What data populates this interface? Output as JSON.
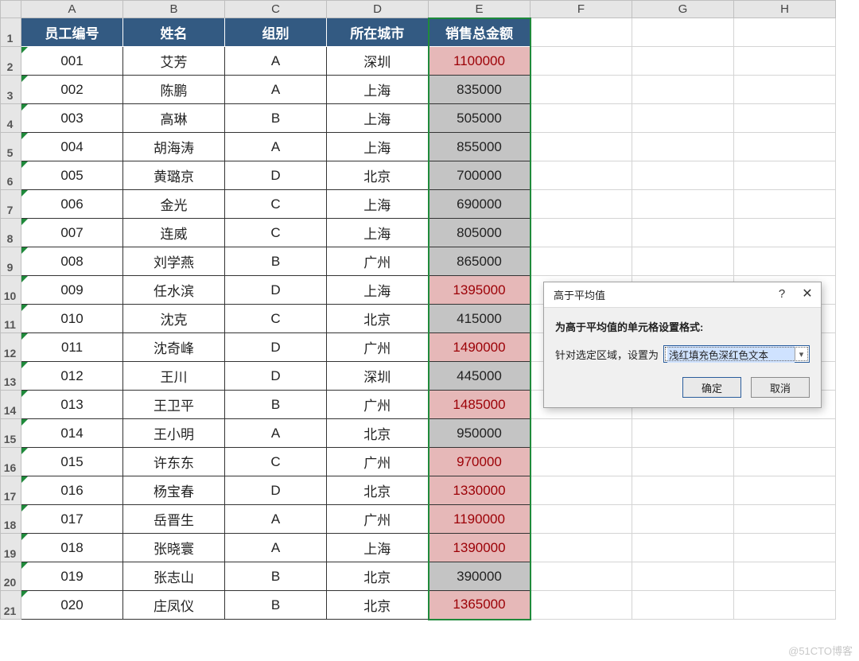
{
  "columns": [
    "A",
    "B",
    "C",
    "D",
    "E",
    "F",
    "G",
    "H"
  ],
  "row_numbers": [
    1,
    2,
    3,
    4,
    5,
    6,
    7,
    8,
    9,
    10,
    11,
    12,
    13,
    14,
    15,
    16,
    17,
    18,
    19,
    20,
    21
  ],
  "headers": {
    "A": "员工编号",
    "B": "姓名",
    "C": "组别",
    "D": "所在城市",
    "E": "销售总金额"
  },
  "rows": [
    {
      "id": "001",
      "name": "艾芳",
      "group": "A",
      "city": "深圳",
      "amount": "1100000",
      "hot": true
    },
    {
      "id": "002",
      "name": "陈鹏",
      "group": "A",
      "city": "上海",
      "amount": "835000",
      "hot": false
    },
    {
      "id": "003",
      "name": "高琳",
      "group": "B",
      "city": "上海",
      "amount": "505000",
      "hot": false
    },
    {
      "id": "004",
      "name": "胡海涛",
      "group": "A",
      "city": "上海",
      "amount": "855000",
      "hot": false
    },
    {
      "id": "005",
      "name": "黄璐京",
      "group": "D",
      "city": "北京",
      "amount": "700000",
      "hot": false
    },
    {
      "id": "006",
      "name": "金光",
      "group": "C",
      "city": "上海",
      "amount": "690000",
      "hot": false
    },
    {
      "id": "007",
      "name": "连威",
      "group": "C",
      "city": "上海",
      "amount": "805000",
      "hot": false
    },
    {
      "id": "008",
      "name": "刘学燕",
      "group": "B",
      "city": "广州",
      "amount": "865000",
      "hot": false
    },
    {
      "id": "009",
      "name": "任水滨",
      "group": "D",
      "city": "上海",
      "amount": "1395000",
      "hot": true
    },
    {
      "id": "010",
      "name": "沈克",
      "group": "C",
      "city": "北京",
      "amount": "415000",
      "hot": false
    },
    {
      "id": "011",
      "name": "沈奇峰",
      "group": "D",
      "city": "广州",
      "amount": "1490000",
      "hot": true
    },
    {
      "id": "012",
      "name": "王川",
      "group": "D",
      "city": "深圳",
      "amount": "445000",
      "hot": false
    },
    {
      "id": "013",
      "name": "王卫平",
      "group": "B",
      "city": "广州",
      "amount": "1485000",
      "hot": true
    },
    {
      "id": "014",
      "name": "王小明",
      "group": "A",
      "city": "北京",
      "amount": "950000",
      "hot": false
    },
    {
      "id": "015",
      "name": "许东东",
      "group": "C",
      "city": "广州",
      "amount": "970000",
      "hot": true
    },
    {
      "id": "016",
      "name": "杨宝春",
      "group": "D",
      "city": "北京",
      "amount": "1330000",
      "hot": true
    },
    {
      "id": "017",
      "name": "岳晋生",
      "group": "A",
      "city": "广州",
      "amount": "1190000",
      "hot": true
    },
    {
      "id": "018",
      "name": "张晓寰",
      "group": "A",
      "city": "上海",
      "amount": "1390000",
      "hot": true
    },
    {
      "id": "019",
      "name": "张志山",
      "group": "B",
      "city": "北京",
      "amount": "390000",
      "hot": false
    },
    {
      "id": "020",
      "name": "庄凤仪",
      "group": "B",
      "city": "北京",
      "amount": "1365000",
      "hot": true
    }
  ],
  "dialog": {
    "title": "高于平均值",
    "heading": "为高于平均值的单元格设置格式:",
    "prefix": "针对选定区域，设置为",
    "combo_value": "浅红填充色深红色文本",
    "ok": "确定",
    "cancel": "取消"
  },
  "watermark": "@51CTO博客"
}
